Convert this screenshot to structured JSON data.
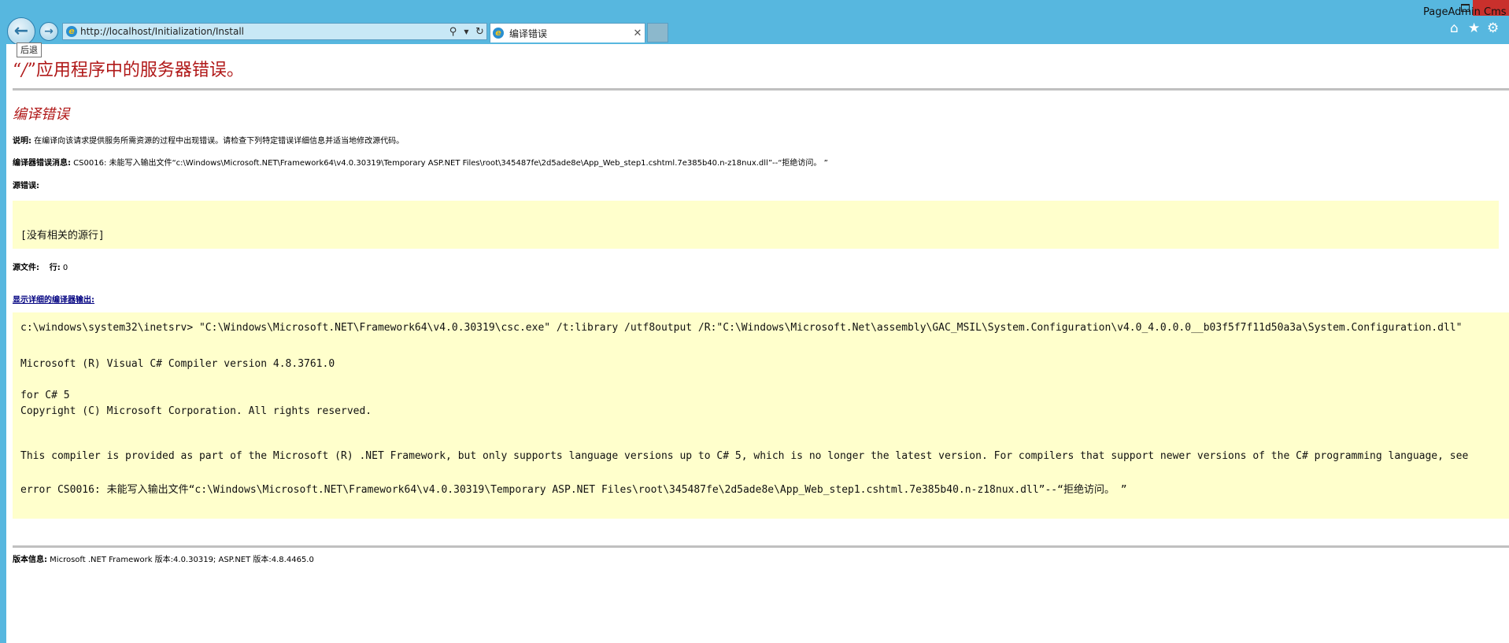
{
  "window": {
    "title": "PageAdmin Cms"
  },
  "browser": {
    "back_tooltip": "后退",
    "address_url": "http://localhost/Initialization/Install",
    "tab_title": "编译错误",
    "icons": {
      "back": "back-arrow-icon",
      "forward": "forward-arrow-icon",
      "page": "ie-page-icon",
      "search": "search-icon",
      "dropdown": "chevron-down-icon",
      "refresh": "refresh-icon",
      "close": "close-icon",
      "home": "home-icon",
      "favorites": "star-icon",
      "settings": "gear-icon"
    },
    "colors": {
      "chrome": "#57b7df",
      "close_button": "#c9302c"
    }
  },
  "page": {
    "title_quote_open": "“",
    "title_slash": "/",
    "title_quote_close": "”",
    "title_rest": "应用程序中的服务器错误。",
    "heading": "编译错误",
    "description_label": "说明:",
    "description_text": " 在编译向该请求提供服务所需资源的过程中出现错误。请检查下列特定错误详细信息并适当地修改源代码。",
    "compile_msg_label": "编译器错误消息:",
    "compile_msg_text": " CS0016: 未能写入输出文件“c:\\Windows\\Microsoft.NET\\Framework64\\v4.0.30319\\Temporary ASP.NET Files\\root\\345487fe\\2d5ade8e\\App_Web_step1.cshtml.7e385b40.n-z18nux.dll”--“拒绝访问。 ”",
    "source_error_label": "源错误:",
    "no_source_text": "[没有相关的源行]",
    "source_file_label": "源文件:",
    "line_label": "行:",
    "line_value": "0",
    "show_output_link": "显示详细的编译器输出:",
    "compiler_output": {
      "command": "c:\\windows\\system32\\inetsrv> \"C:\\Windows\\Microsoft.NET\\Framework64\\v4.0.30319\\csc.exe\" /t:library /utf8output /R:\"C:\\Windows\\Microsoft.Net\\assembly\\GAC_MSIL\\System.Configuration\\v4.0_4.0.0.0__b03f5f7f11d50a3a\\System.Configuration.dll\"",
      "version": "Microsoft (R) Visual C# Compiler version 4.8.3761.0",
      "for_cs": "for C# 5",
      "copyright": "Copyright (C) Microsoft Corporation. All rights reserved.",
      "notice": "This compiler is provided as part of the Microsoft (R) .NET Framework, but only supports language versions up to C# 5, which is no longer the latest version. For compilers that support newer versions of the C# programming language, see",
      "error": "error CS0016: 未能写入输出文件“c:\\Windows\\Microsoft.NET\\Framework64\\v4.0.30319\\Temporary ASP.NET Files\\root\\345487fe\\2d5ade8e\\App_Web_step1.cshtml.7e385b40.n-z18nux.dll”--“拒绝访问。 ”"
    },
    "version_label": "版本信息:",
    "version_text": " Microsoft .NET Framework 版本:4.0.30319; ASP.NET 版本:4.8.4465.0",
    "colors": {
      "title_red": "#b01818",
      "code_background": "#ffffcc",
      "link_navy": "#000080",
      "rule_gray": "#c0c0c0"
    }
  }
}
